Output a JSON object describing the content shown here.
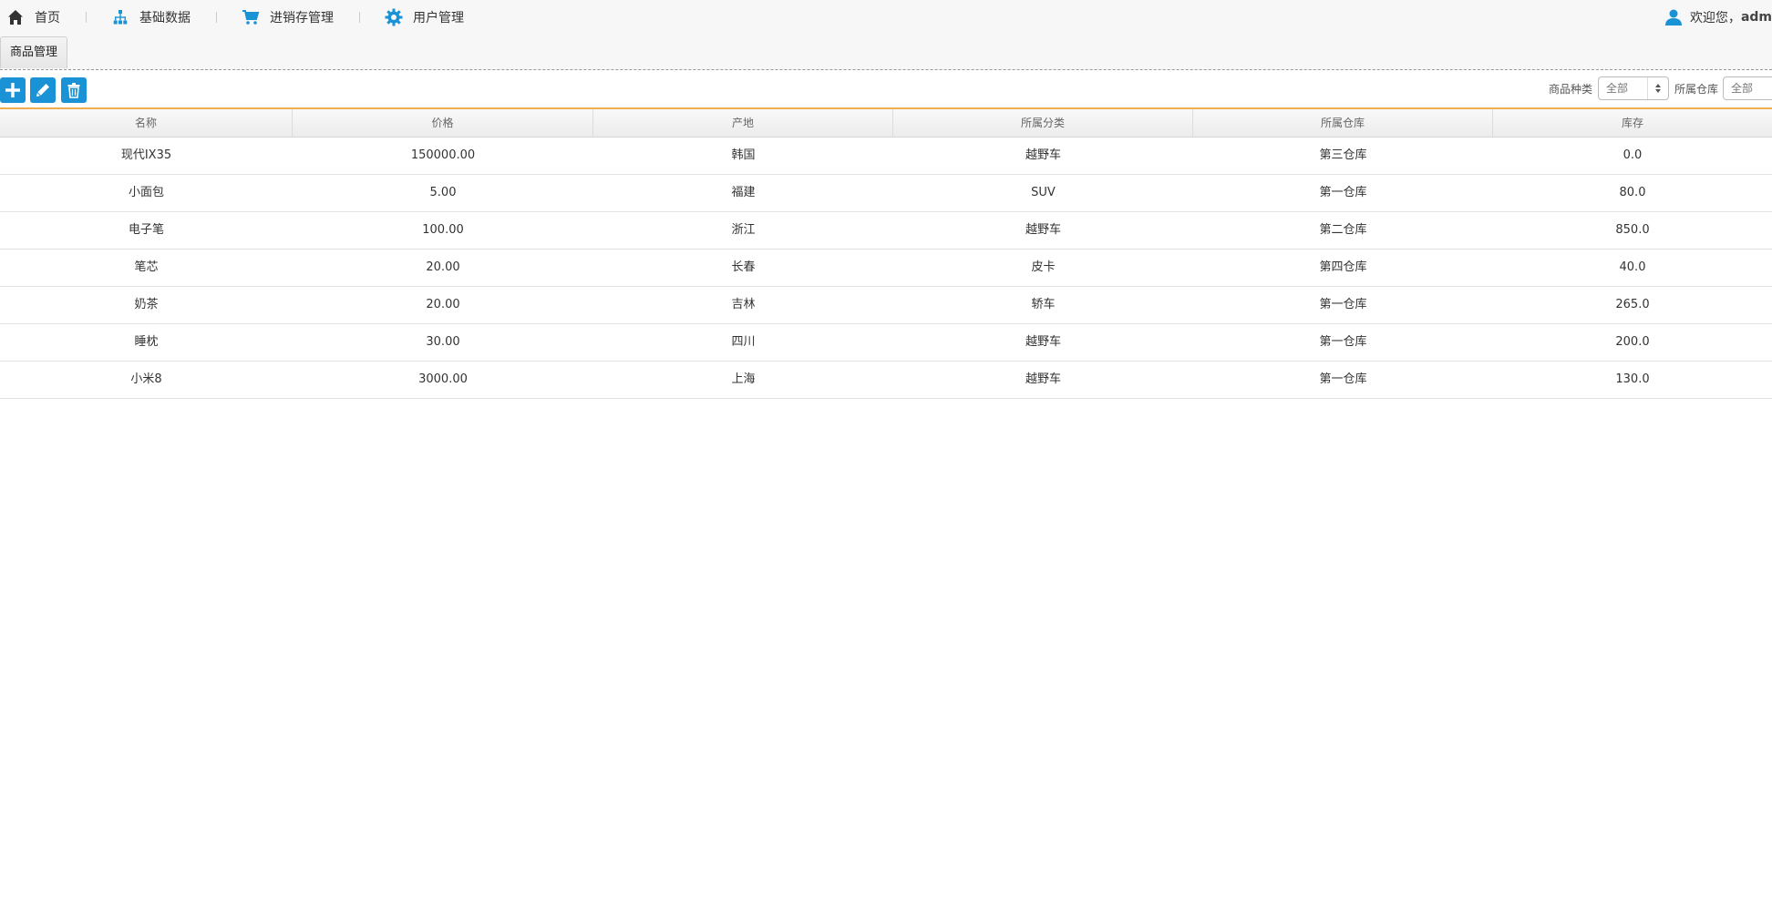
{
  "nav": {
    "items": [
      {
        "label": "首页",
        "icon": "home-icon"
      },
      {
        "label": "基础数据",
        "icon": "sitemap-icon"
      },
      {
        "label": "进销存管理",
        "icon": "cart-icon"
      },
      {
        "label": "用户管理",
        "icon": "gear-icon"
      }
    ],
    "welcome_text": "欢迎您，",
    "user_name": "adm"
  },
  "tabs": [
    {
      "label": "商品管理",
      "active": true
    }
  ],
  "toolbar": {
    "buttons": [
      {
        "name": "add-button",
        "icon": "plus-icon"
      },
      {
        "name": "edit-button",
        "icon": "pencil-icon"
      },
      {
        "name": "delete-button",
        "icon": "trash-icon"
      }
    ],
    "filters": [
      {
        "label": "商品种类",
        "value": "全部"
      },
      {
        "label": "所属仓库",
        "value": "全部"
      }
    ]
  },
  "colors": {
    "accent": "#1a93d6",
    "toolbar_border": "#f0ad4e"
  },
  "table": {
    "columns": [
      "名称",
      "价格",
      "产地",
      "所属分类",
      "所属仓库",
      "库存"
    ],
    "rows": [
      [
        "现代IX35",
        "150000.00",
        "韩国",
        "越野车",
        "第三仓库",
        "0.0"
      ],
      [
        "小面包",
        "5.00",
        "福建",
        "SUV",
        "第一仓库",
        "80.0"
      ],
      [
        "电子笔",
        "100.00",
        "浙江",
        "越野车",
        "第二仓库",
        "850.0"
      ],
      [
        "笔芯",
        "20.00",
        "长春",
        "皮卡",
        "第四仓库",
        "40.0"
      ],
      [
        "奶茶",
        "20.00",
        "吉林",
        "轿车",
        "第一仓库",
        "265.0"
      ],
      [
        "睡枕",
        "30.00",
        "四川",
        "越野车",
        "第一仓库",
        "200.0"
      ],
      [
        "小米8",
        "3000.00",
        "上海",
        "越野车",
        "第一仓库",
        "130.0"
      ]
    ]
  }
}
